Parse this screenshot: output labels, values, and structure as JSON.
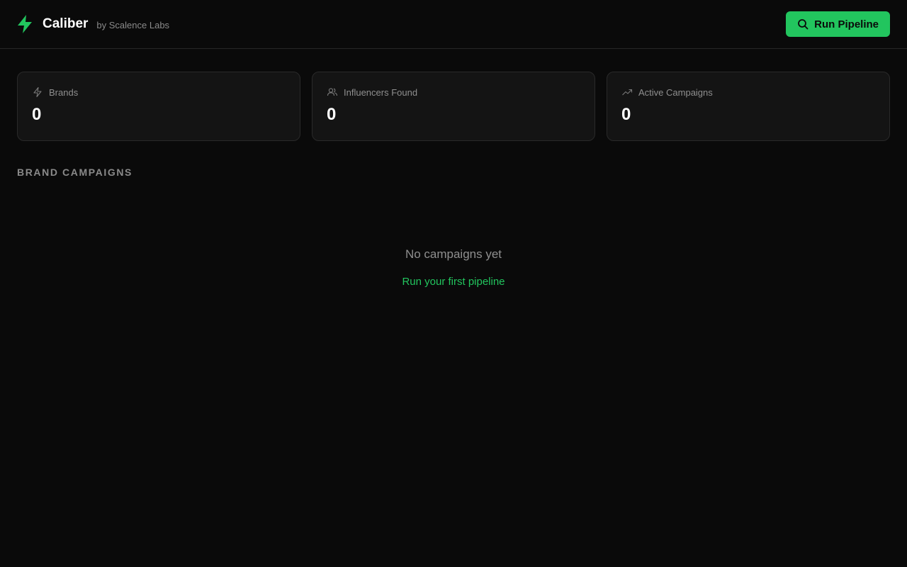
{
  "header": {
    "title": "Caliber",
    "subtitle": "by Scalence Labs",
    "run_button_label": "Run Pipeline",
    "logo_icon": "lightning-bolt-icon",
    "accent_color": "#22c55e"
  },
  "stats": [
    {
      "icon": "zap-outline-icon",
      "label": "Brands",
      "value": "0"
    },
    {
      "icon": "users-icon",
      "label": "Influencers Found",
      "value": "0"
    },
    {
      "icon": "trending-up-icon",
      "label": "Active Campaigns",
      "value": "0"
    }
  ],
  "section": {
    "title": "BRAND CAMPAIGNS"
  },
  "empty_state": {
    "message": "No campaigns yet",
    "link_label": "Run your first pipeline"
  }
}
